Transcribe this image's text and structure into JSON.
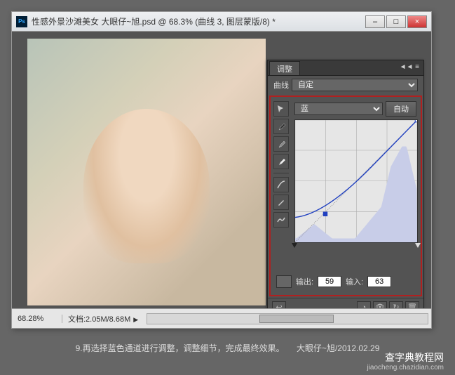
{
  "titlebar": {
    "app_icon": "Ps",
    "title": "性感外景沙滩美女 大眼仔~旭.psd @ 68.3% (曲线 3, 图层蒙版/8) *",
    "min": "–",
    "max": "□",
    "close": "×"
  },
  "panel": {
    "tab": "调整",
    "curves_label": "曲线",
    "preset_value": "自定",
    "channel_value": "蓝",
    "auto_label": "自动",
    "output_label": "输出:",
    "output_value": "59",
    "input_label": "输入:",
    "input_value": "63",
    "tool_names": [
      "pointer-icon",
      "eyedropper-black-icon",
      "eyedropper-gray-icon",
      "eyedropper-white-icon",
      "curve-icon",
      "pencil-icon",
      "smooth-icon"
    ]
  },
  "chart_data": {
    "type": "line",
    "title": "",
    "channel": "蓝",
    "xlabel": "",
    "ylabel": "",
    "x_range": [
      0,
      255
    ],
    "y_range": [
      0,
      255
    ],
    "grid": [
      0,
      64,
      128,
      192,
      255
    ],
    "histogram_peak_indices": [
      180,
      210,
      230
    ],
    "baseline": [
      [
        0,
        0
      ],
      [
        255,
        255
      ]
    ],
    "curve_points": [
      [
        0,
        52
      ],
      [
        63,
        59
      ],
      [
        255,
        255
      ]
    ],
    "handles": [
      63,
      255
    ],
    "slider_black": 0,
    "slider_white": 255
  },
  "statusbar": {
    "zoom": "68.28%",
    "doc_label": "文档:2.05M/8.68M"
  },
  "caption": {
    "text": "9.再选择蓝色通道进行调整，调整细节，完成最终效果。",
    "credit": "大眼仔~旭/2012.02.29"
  },
  "watermark": {
    "title": "查字典教程网",
    "url": "jiaocheng.chazidian.com"
  }
}
